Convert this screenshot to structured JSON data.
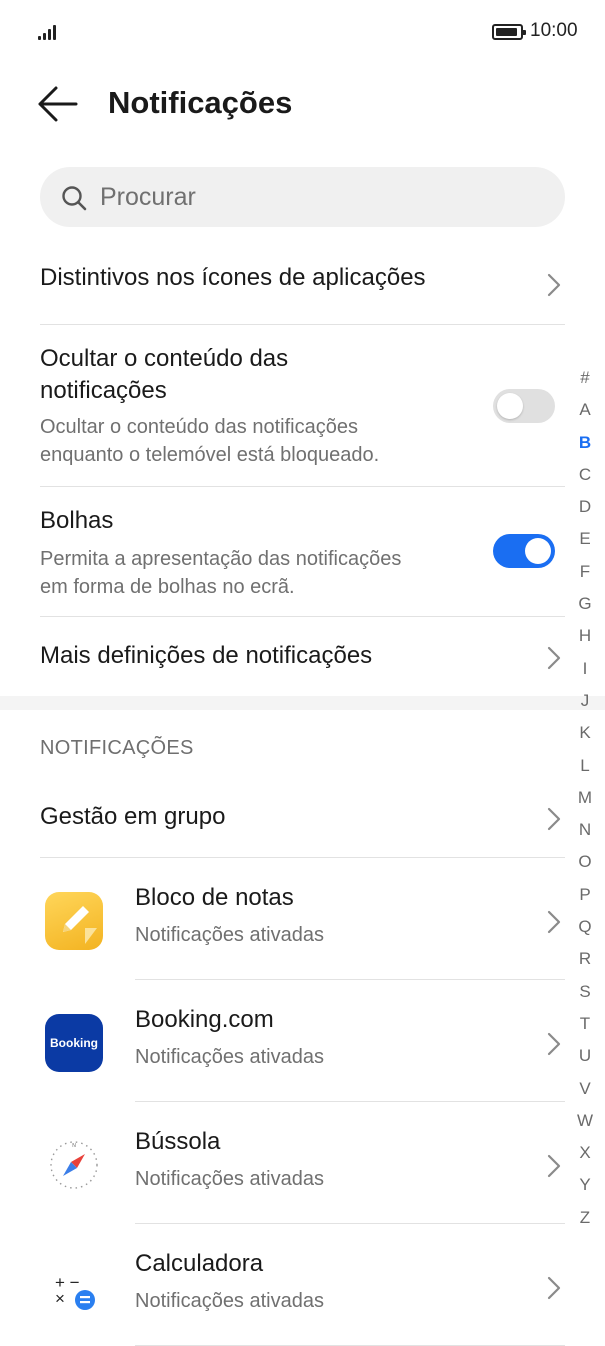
{
  "status_bar": {
    "time": "10:00",
    "signal_icon": "signal-icon",
    "battery_icon": "battery-icon"
  },
  "header": {
    "title": "Notificações",
    "back_icon": "back-arrow-icon"
  },
  "search": {
    "placeholder": "Procurar",
    "icon": "search-icon"
  },
  "settings": {
    "badges": {
      "title": "Distintivos nos ícones de aplicações"
    },
    "hide_content": {
      "title_line1": "Ocultar o conteúdo das",
      "title_line2": "notificações",
      "sub_line1": "Ocultar o conteúdo das notificações",
      "sub_line2": "enquanto o telemóvel está bloqueado.",
      "enabled": false
    },
    "bubbles": {
      "title": "Bolhas",
      "sub_line1": "Permita a apresentação das notificações",
      "sub_line2": "em forma de bolhas no ecrã.",
      "enabled": true
    },
    "more": {
      "title": "Mais definições de notificações"
    }
  },
  "notifications_section": {
    "label": "NOTIFICAÇÕES",
    "group_management": "Gestão em grupo",
    "apps": [
      {
        "name": "Bloco de notas",
        "status": "Notificações ativadas",
        "icon": "notepad-icon"
      },
      {
        "name": "Booking.com",
        "status": "Notificações ativadas",
        "icon": "booking-icon",
        "icon_text": "Booking"
      },
      {
        "name": "Bússola",
        "status": "Notificações ativadas",
        "icon": "compass-icon",
        "icon_text": "N"
      },
      {
        "name": "Calculadora",
        "status": "Notificações ativadas",
        "icon": "calculator-icon",
        "icon_text": "+ −\n×"
      }
    ]
  },
  "alpha_index": {
    "letters": [
      "#",
      "A",
      "B",
      "C",
      "D",
      "E",
      "F",
      "G",
      "H",
      "I",
      "J",
      "K",
      "L",
      "M",
      "N",
      "O",
      "P",
      "Q",
      "R",
      "S",
      "T",
      "U",
      "V",
      "W",
      "X",
      "Y",
      "Z"
    ],
    "active": "B"
  },
  "colors": {
    "accent": "#1a6ef2",
    "booking_blue": "#0b3aa4",
    "notepad_yellow": "#f7c331"
  }
}
